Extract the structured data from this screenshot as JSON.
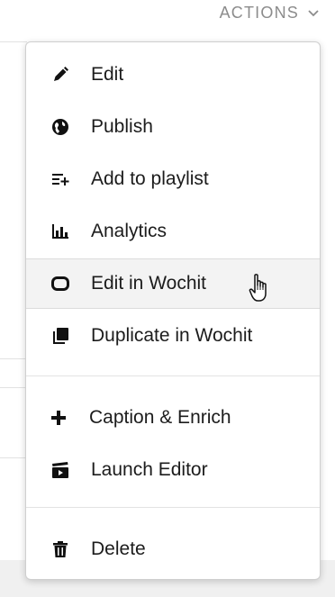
{
  "header": {
    "actions_label": "ACTIONS"
  },
  "menu": {
    "items": [
      {
        "label": "Edit",
        "icon": "pencil-icon"
      },
      {
        "label": "Publish",
        "icon": "globe-icon"
      },
      {
        "label": "Add to playlist",
        "icon": "playlist-add-icon"
      },
      {
        "label": "Analytics",
        "icon": "bar-chart-icon"
      },
      {
        "label": "Edit in Wochit",
        "icon": "rounded-square-icon"
      },
      {
        "label": "Duplicate in Wochit",
        "icon": "copy-icon"
      },
      {
        "label": "Caption & Enrich",
        "icon": "plus-icon"
      },
      {
        "label": "Launch Editor",
        "icon": "clapperboard-icon"
      },
      {
        "label": "Delete",
        "icon": "trash-icon"
      }
    ]
  },
  "colors": {
    "text": "#1c1c1c",
    "muted": "#8c8c8c",
    "hover_bg": "#f3f3f3"
  }
}
